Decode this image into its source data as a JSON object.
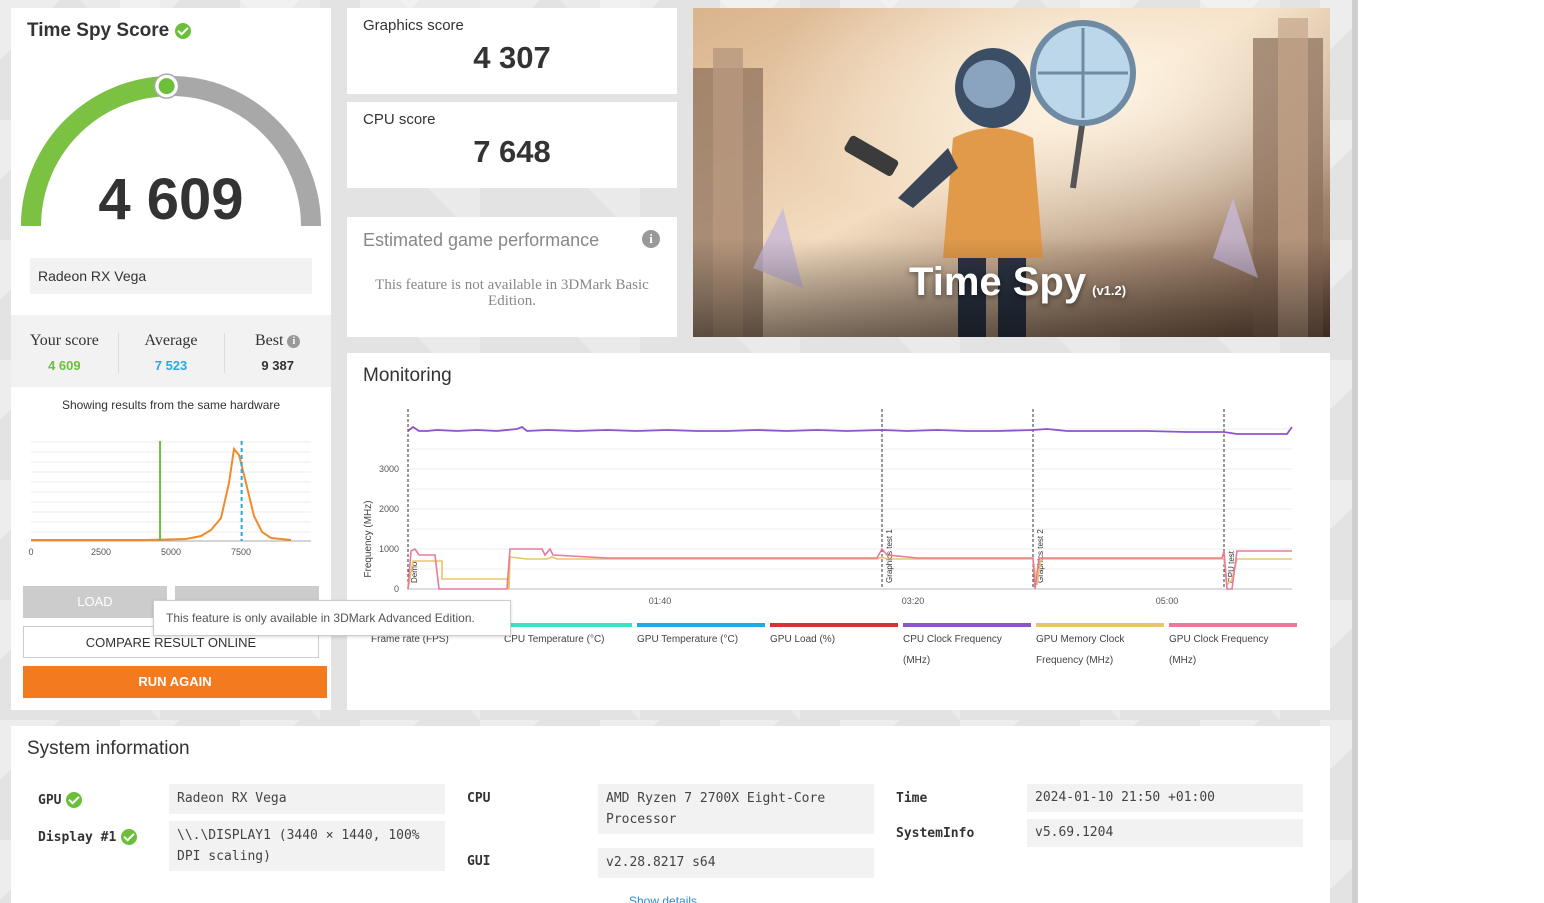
{
  "score_card": {
    "title": "Time Spy Score",
    "score": "4 609",
    "gauge_fraction": 0.49,
    "gpu_name": "Radeon RX Vega",
    "your_score_label": "Your score",
    "your_score": "4 609",
    "average_label": "Average",
    "average": "7 523",
    "best_label": "Best",
    "best": "9 387",
    "same_hardware_text": "Showing results from the same hardware",
    "load_label": "LOAD",
    "tooltip": "This feature is only available in 3DMark Advanced Edition.",
    "compare_label": "COMPARE RESULT ONLINE",
    "run_again_label": "RUN AGAIN",
    "distribution": {
      "x_ticks": [
        "0",
        "2500",
        "5000",
        "7500"
      ],
      "your_score_value": 4609,
      "average_value": 7523
    }
  },
  "graphics": {
    "label": "Graphics score",
    "value": "4 307"
  },
  "cpu": {
    "label": "CPU score",
    "value": "7 648"
  },
  "estimated": {
    "title": "Estimated game performance",
    "message": "This feature is not available in 3DMark Basic Edition."
  },
  "hero": {
    "title": "Time Spy",
    "version": "(v1.2)"
  },
  "monitoring": {
    "title": "Monitoring",
    "y_label": "Frequency (MHz)",
    "y_ticks": [
      "3000",
      "2000",
      "1000",
      "0"
    ],
    "x_ticks": [
      "01:40",
      "03:20",
      "05:00"
    ],
    "markers": [
      "Demo",
      "Graphics test 1",
      "Graphics test 2",
      "CPU test"
    ],
    "legend": [
      {
        "label": "Frame rate (FPS)",
        "color": "#f08a2a"
      },
      {
        "label": "CPU Temperature (°C)",
        "color": "#3fe0c5"
      },
      {
        "label": "GPU Temperature (°C)",
        "color": "#26a9e0"
      },
      {
        "label": "GPU Load (%)",
        "color": "#d63434"
      },
      {
        "label": "CPU Clock Frequency (MHz)",
        "color": "#8e54c9"
      },
      {
        "label": "GPU Memory Clock Frequency (MHz)",
        "color": "#e8c56a"
      },
      {
        "label": "GPU Clock Frequency (MHz)",
        "color": "#e87a9a"
      }
    ]
  },
  "system_info": {
    "title": "System information",
    "gpu_label": "GPU",
    "gpu_value": "Radeon RX Vega",
    "display_label": "Display #1",
    "display_value": "\\\\.\\DISPLAY1 (3440 × 1440, 100% DPI scaling)",
    "cpu_label": "CPU",
    "cpu_value": "AMD Ryzen 7 2700X Eight-Core Processor",
    "gui_label": "GUI",
    "gui_value": "v2.28.8217 s64",
    "time_label": "Time",
    "time_value": "2024-01-10 21:50 +01:00",
    "sysinfo_label": "SystemInfo",
    "sysinfo_value": "v5.69.1204",
    "show_details": "Show details"
  },
  "colors": {
    "accent_orange": "#f47a20",
    "score_green": "#6cbf3a",
    "average_blue": "#26a9e0"
  }
}
